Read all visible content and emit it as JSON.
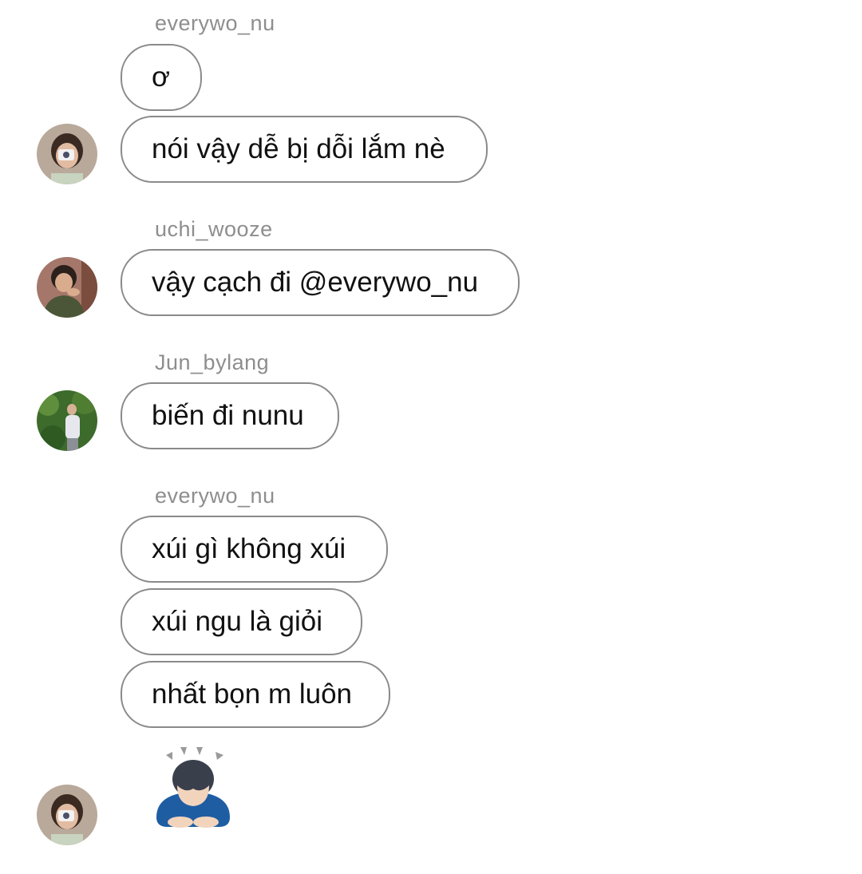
{
  "thread": [
    {
      "sender": "everywo_nu",
      "messages": [
        "ơ",
        "nói vậy dễ bị dỗi lắm nè"
      ],
      "avatar": "avatar-camera-boy"
    },
    {
      "sender": "uchi_wooze",
      "messages": [
        "vậy cạch đi @everywo_nu"
      ],
      "avatar": "avatar-green-shirt"
    },
    {
      "sender": "Jun_bylang",
      "messages": [
        "biến đi nunu"
      ],
      "avatar": "avatar-forest"
    },
    {
      "sender": "everywo_nu",
      "messages": [
        "xúi gì không xúi",
        "xúi ngu là giỏi",
        "nhất bọn m luôn"
      ],
      "reaction": "person-bowing-emoji",
      "avatar": "avatar-camera-boy"
    }
  ],
  "colors": {
    "bubble_border": "#8a8a8a",
    "sender_text": "#8e8e8e",
    "message_text": "#111111",
    "background": "#ffffff"
  }
}
